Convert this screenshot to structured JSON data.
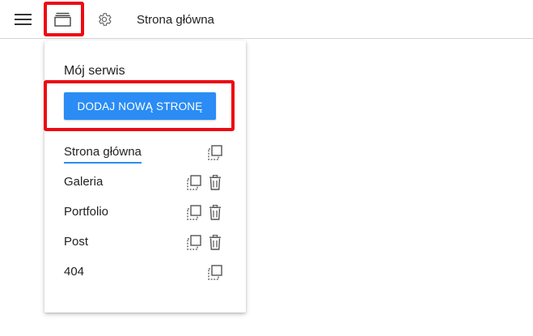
{
  "topbar": {
    "breadcrumb": "Strona główna",
    "icons": {
      "menu": "hamburger-menu-icon",
      "pages": "pages-stack-icon",
      "settings": "gear-icon"
    }
  },
  "panel": {
    "title": "Mój serwis",
    "add_button_label": "DODAJ NOWĄ STRONĘ",
    "pages": [
      {
        "label": "Strona główna",
        "active": true,
        "actions": [
          "duplicate"
        ]
      },
      {
        "label": "Galeria",
        "active": false,
        "actions": [
          "duplicate",
          "delete"
        ]
      },
      {
        "label": "Portfolio",
        "active": false,
        "actions": [
          "duplicate",
          "delete"
        ]
      },
      {
        "label": "Post",
        "active": false,
        "actions": [
          "duplicate",
          "delete"
        ]
      },
      {
        "label": "404",
        "active": false,
        "actions": [
          "duplicate"
        ]
      }
    ]
  },
  "colors": {
    "accent": "#2a8cf4",
    "highlight": "#ec0a13",
    "text": "#212121",
    "icon": "#5f6368"
  }
}
